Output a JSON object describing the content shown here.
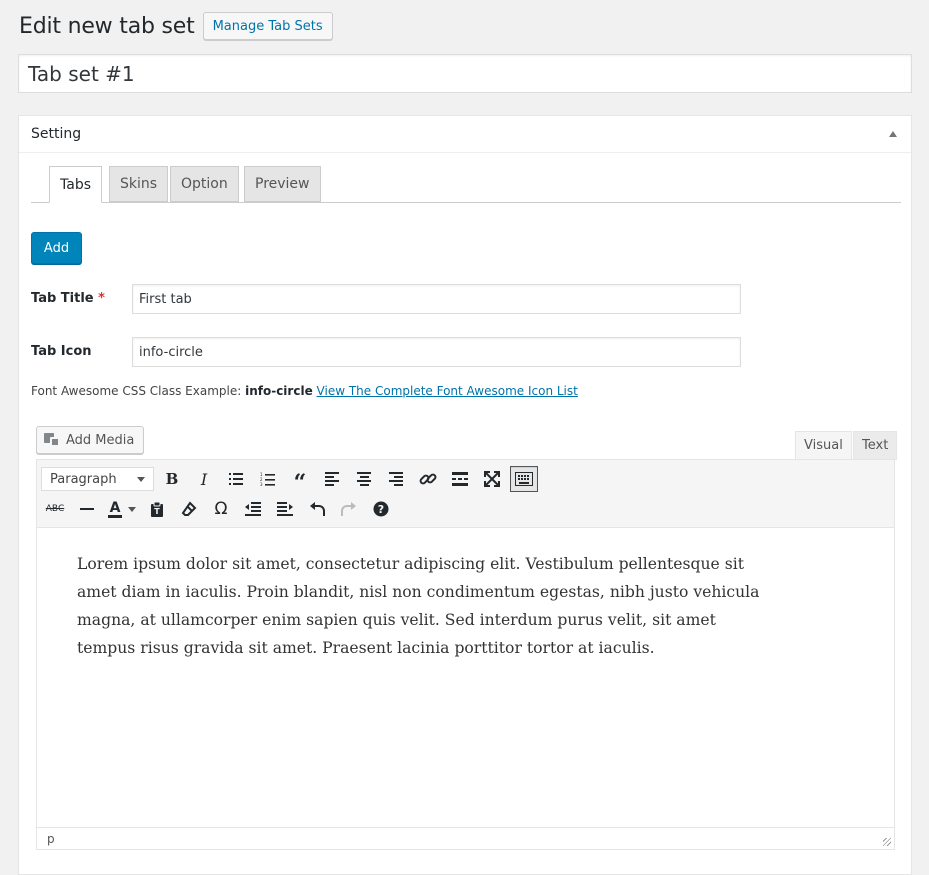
{
  "page": {
    "title": "Edit new tab set",
    "manage_button": "Manage Tab Sets",
    "tabset_title": "Tab set #1"
  },
  "postbox": {
    "title": "Setting"
  },
  "tabs": [
    {
      "label": "Tabs",
      "active": true
    },
    {
      "label": "Skins",
      "active": false
    },
    {
      "label": "Option",
      "active": false
    },
    {
      "label": "Preview",
      "active": false
    }
  ],
  "form": {
    "add_button": "Add",
    "tab_title_label": "Tab Title",
    "required_mark": "*",
    "tab_title_value": "First tab",
    "tab_icon_label": "Tab Icon",
    "tab_icon_value": "info-circle",
    "fa_note_prefix": "Font Awesome CSS Class Example:",
    "fa_note_example": "info-circle",
    "fa_note_link": "View The Complete Font Awesome Icon List"
  },
  "editor": {
    "add_media_label": "Add Media",
    "mode_tabs": [
      "Visual",
      "Text"
    ],
    "format_select": "Paragraph",
    "content": "Lorem ipsum dolor sit amet, consectetur adipiscing elit. Vestibulum pellentesque sit amet diam in iaculis. Proin blandit, nisl non condimentum egestas, nibh justo vehicula magna, at ullamcorper enim sapien quis velit. Sed interdum purus velit, sit amet tempus risus gravida sit amet. Praesent lacinia porttitor tortor at iaculis.",
    "status_path": "p",
    "toolbar_row1": [
      "bold-icon",
      "italic-icon",
      "bullet-list-icon",
      "numbered-list-icon",
      "blockquote-icon",
      "align-left-icon",
      "align-center-icon",
      "align-right-icon",
      "link-icon",
      "read-more-icon",
      "fullscreen-icon",
      "toolbar-toggle-icon"
    ],
    "toolbar_row2": [
      "strikethrough-icon",
      "horizontal-line-icon",
      "text-color-icon",
      "paste-text-icon",
      "clear-formatting-icon",
      "special-character-icon",
      "outdent-icon",
      "indent-icon",
      "undo-icon",
      "redo-icon",
      "help-icon"
    ]
  },
  "colors": {
    "primary_button": "#0085ba",
    "link": "#0073aa",
    "required": "#dc3232",
    "background": "#f1f1f1"
  }
}
